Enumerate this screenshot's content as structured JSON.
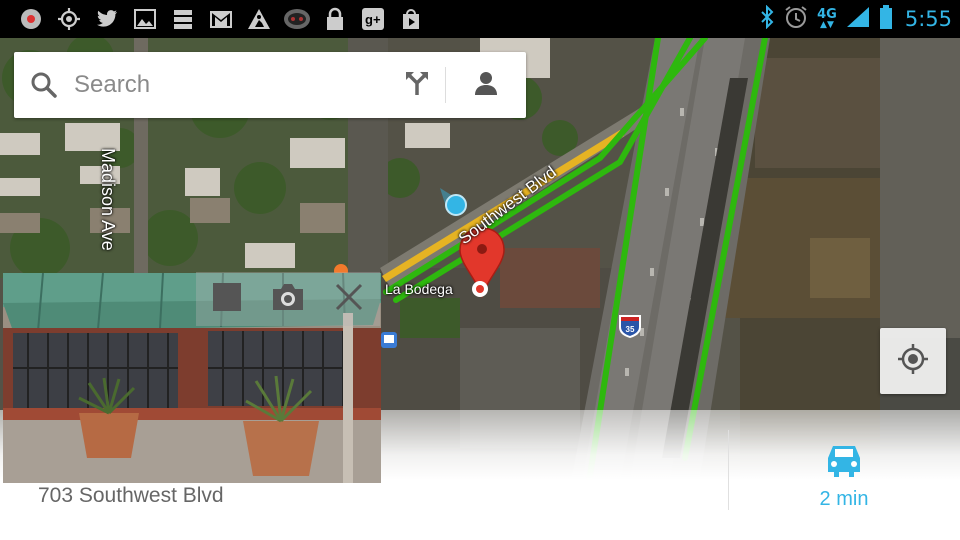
{
  "status_bar": {
    "time": "5:55",
    "network": "4G",
    "notification_icons": [
      "record-icon",
      "gps-icon",
      "twitter-icon",
      "gallery-icon",
      "list-icon",
      "gmail-icon",
      "construction-icon",
      "voicemail-icon",
      "lock-icon",
      "google-plus-icon",
      "play-store-icon"
    ],
    "system_icons": [
      "bluetooth-icon",
      "alarm-icon",
      "signal-icon",
      "battery-icon"
    ],
    "accent_color": "#33b5e5"
  },
  "search": {
    "placeholder": "Search"
  },
  "map": {
    "streets": {
      "madison": "Madison Ave",
      "southwest": "Southwest Blvd"
    },
    "poi": {
      "name": "La Bodega"
    },
    "highway_shield": "35",
    "traffic_color": "#2eb80e"
  },
  "place_sheet": {
    "address": "703 Southwest Blvd",
    "drive_time": "2 min"
  }
}
